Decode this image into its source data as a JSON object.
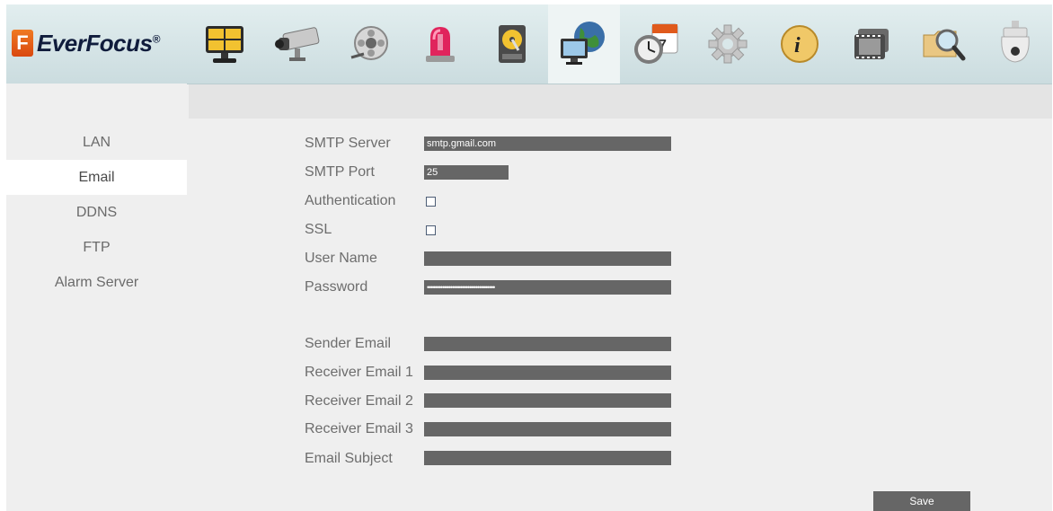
{
  "brand": {
    "name": "EverFocus",
    "mark": "F",
    "reg": "®"
  },
  "toolbar": [
    {
      "icon": "live-view-icon"
    },
    {
      "icon": "camera-icon"
    },
    {
      "icon": "record-icon"
    },
    {
      "icon": "alarm-icon"
    },
    {
      "icon": "disk-icon"
    },
    {
      "icon": "network-icon",
      "active": true
    },
    {
      "icon": "schedule-icon"
    },
    {
      "icon": "settings-gear-icon"
    },
    {
      "icon": "info-icon"
    },
    {
      "icon": "playback-icon"
    },
    {
      "icon": "search-icon"
    },
    {
      "icon": "ptz-dome-icon"
    }
  ],
  "sidebar": {
    "items": [
      {
        "label": "LAN"
      },
      {
        "label": "Email",
        "active": true
      },
      {
        "label": "DDNS"
      },
      {
        "label": "FTP"
      },
      {
        "label": "Alarm Server"
      }
    ]
  },
  "form": {
    "smtp_server": {
      "label": "SMTP Server",
      "value": "smtp.gmail.com"
    },
    "smtp_port": {
      "label": "SMTP Port",
      "value": "25"
    },
    "authentication": {
      "label": "Authentication",
      "checked": false
    },
    "ssl": {
      "label": "SSL",
      "checked": false
    },
    "user_name": {
      "label": "User Name",
      "value": ""
    },
    "password": {
      "label": "Password",
      "value": "•••••••••••••••••••••••••••••••••••"
    },
    "sender_email": {
      "label": "Sender Email",
      "value": ""
    },
    "receiver_email_1": {
      "label": "Receiver Email 1",
      "value": ""
    },
    "receiver_email_2": {
      "label": "Receiver Email 2",
      "value": ""
    },
    "receiver_email_3": {
      "label": "Receiver Email 3",
      "value": ""
    },
    "email_subject": {
      "label": "Email Subject",
      "value": ""
    }
  },
  "save_label": "Save",
  "colors": {
    "field_bg": "#666666",
    "toolbar_bg": "#d5e5e7",
    "logo_orange": "#e8601a"
  }
}
